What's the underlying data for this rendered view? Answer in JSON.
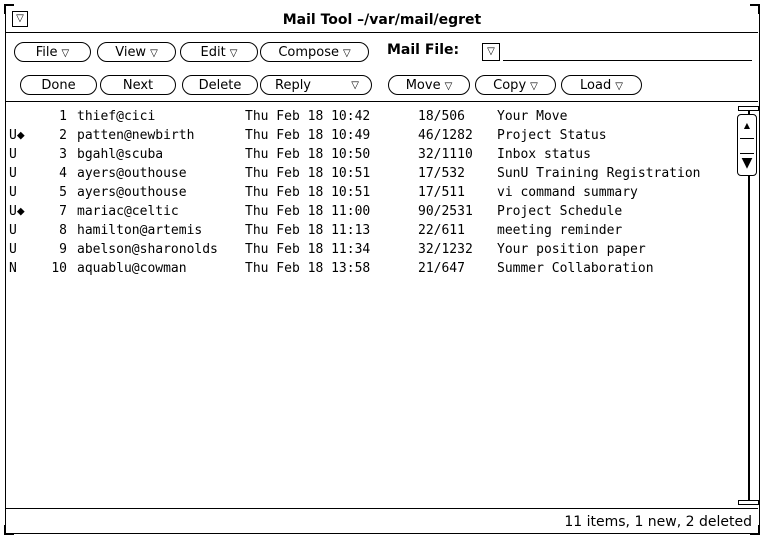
{
  "window": {
    "title": "Mail Tool  –/var/mail/egret",
    "menu_glyph": "▽"
  },
  "toolbar_row1": {
    "file": "File",
    "view": "View",
    "edit": "Edit",
    "compose": "Compose",
    "mail_file_label": "Mail File:",
    "mail_file_value": ""
  },
  "toolbar_row2": {
    "done": "Done",
    "next": "Next",
    "delete": "Delete",
    "reply": "Reply",
    "move": "Move",
    "copy": "Copy",
    "load": "Load"
  },
  "menu_triangle": "▽",
  "messages": [
    {
      "flag": "",
      "num": "1",
      "from": "thief@cici",
      "date": "Thu Feb 18 10:42",
      "size": "18/506",
      "subject": "Your Move"
    },
    {
      "flag": "U◆",
      "num": "2",
      "from": "patten@newbirth",
      "date": "Thu Feb 18 10:49",
      "size": "46/1282",
      "subject": "Project Status"
    },
    {
      "flag": "U",
      "num": "3",
      "from": "bgahl@scuba",
      "date": "Thu Feb 18 10:50",
      "size": "32/1110",
      "subject": "Inbox status"
    },
    {
      "flag": "U",
      "num": "4",
      "from": "ayers@outhouse",
      "date": "Thu Feb 18 10:51",
      "size": "17/532",
      "subject": "SunU Training Registration"
    },
    {
      "flag": "U",
      "num": "5",
      "from": "ayers@outhouse",
      "date": "Thu Feb 18 10:51",
      "size": "17/511",
      "subject": "vi command summary"
    },
    {
      "flag": "U◆",
      "num": "7",
      "from": "mariac@celtic",
      "date": "Thu Feb 18 11:00",
      "size": "90/2531",
      "subject": "Project Schedule"
    },
    {
      "flag": "U",
      "num": "8",
      "from": "hamilton@artemis",
      "date": "Thu Feb 18 11:13",
      "size": "22/611",
      "subject": "meeting reminder"
    },
    {
      "flag": "U",
      "num": "9",
      "from": "abelson@sharonolds",
      "date": "Thu Feb 18 11:34",
      "size": "32/1232",
      "subject": "Your position paper"
    },
    {
      "flag": "N",
      "num": "10",
      "from": "aquablu@cowman",
      "date": "Thu Feb 18 13:58",
      "size": "21/647",
      "subject": "Summer Collaboration"
    }
  ],
  "status": "11 items, 1 new, 2 deleted"
}
